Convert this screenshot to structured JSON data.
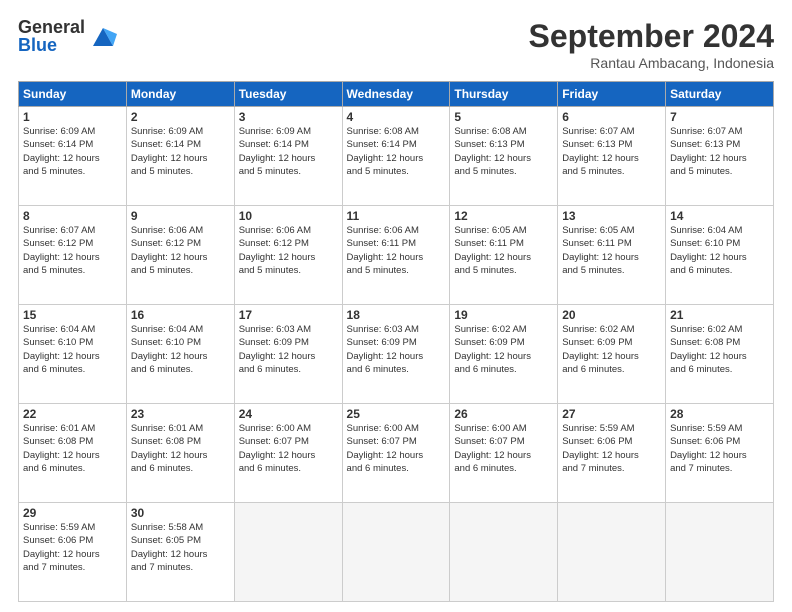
{
  "logo": {
    "general": "General",
    "blue": "Blue"
  },
  "header": {
    "month": "September 2024",
    "location": "Rantau Ambacang, Indonesia"
  },
  "weekdays": [
    "Sunday",
    "Monday",
    "Tuesday",
    "Wednesday",
    "Thursday",
    "Friday",
    "Saturday"
  ],
  "weeks": [
    [
      {
        "day": "1",
        "info": "Sunrise: 6:09 AM\nSunset: 6:14 PM\nDaylight: 12 hours\nand 5 minutes."
      },
      {
        "day": "2",
        "info": "Sunrise: 6:09 AM\nSunset: 6:14 PM\nDaylight: 12 hours\nand 5 minutes."
      },
      {
        "day": "3",
        "info": "Sunrise: 6:09 AM\nSunset: 6:14 PM\nDaylight: 12 hours\nand 5 minutes."
      },
      {
        "day": "4",
        "info": "Sunrise: 6:08 AM\nSunset: 6:14 PM\nDaylight: 12 hours\nand 5 minutes."
      },
      {
        "day": "5",
        "info": "Sunrise: 6:08 AM\nSunset: 6:13 PM\nDaylight: 12 hours\nand 5 minutes."
      },
      {
        "day": "6",
        "info": "Sunrise: 6:07 AM\nSunset: 6:13 PM\nDaylight: 12 hours\nand 5 minutes."
      },
      {
        "day": "7",
        "info": "Sunrise: 6:07 AM\nSunset: 6:13 PM\nDaylight: 12 hours\nand 5 minutes."
      }
    ],
    [
      {
        "day": "8",
        "info": "Sunrise: 6:07 AM\nSunset: 6:12 PM\nDaylight: 12 hours\nand 5 minutes."
      },
      {
        "day": "9",
        "info": "Sunrise: 6:06 AM\nSunset: 6:12 PM\nDaylight: 12 hours\nand 5 minutes."
      },
      {
        "day": "10",
        "info": "Sunrise: 6:06 AM\nSunset: 6:12 PM\nDaylight: 12 hours\nand 5 minutes."
      },
      {
        "day": "11",
        "info": "Sunrise: 6:06 AM\nSunset: 6:11 PM\nDaylight: 12 hours\nand 5 minutes."
      },
      {
        "day": "12",
        "info": "Sunrise: 6:05 AM\nSunset: 6:11 PM\nDaylight: 12 hours\nand 5 minutes."
      },
      {
        "day": "13",
        "info": "Sunrise: 6:05 AM\nSunset: 6:11 PM\nDaylight: 12 hours\nand 5 minutes."
      },
      {
        "day": "14",
        "info": "Sunrise: 6:04 AM\nSunset: 6:10 PM\nDaylight: 12 hours\nand 6 minutes."
      }
    ],
    [
      {
        "day": "15",
        "info": "Sunrise: 6:04 AM\nSunset: 6:10 PM\nDaylight: 12 hours\nand 6 minutes."
      },
      {
        "day": "16",
        "info": "Sunrise: 6:04 AM\nSunset: 6:10 PM\nDaylight: 12 hours\nand 6 minutes."
      },
      {
        "day": "17",
        "info": "Sunrise: 6:03 AM\nSunset: 6:09 PM\nDaylight: 12 hours\nand 6 minutes."
      },
      {
        "day": "18",
        "info": "Sunrise: 6:03 AM\nSunset: 6:09 PM\nDaylight: 12 hours\nand 6 minutes."
      },
      {
        "day": "19",
        "info": "Sunrise: 6:02 AM\nSunset: 6:09 PM\nDaylight: 12 hours\nand 6 minutes."
      },
      {
        "day": "20",
        "info": "Sunrise: 6:02 AM\nSunset: 6:09 PM\nDaylight: 12 hours\nand 6 minutes."
      },
      {
        "day": "21",
        "info": "Sunrise: 6:02 AM\nSunset: 6:08 PM\nDaylight: 12 hours\nand 6 minutes."
      }
    ],
    [
      {
        "day": "22",
        "info": "Sunrise: 6:01 AM\nSunset: 6:08 PM\nDaylight: 12 hours\nand 6 minutes."
      },
      {
        "day": "23",
        "info": "Sunrise: 6:01 AM\nSunset: 6:08 PM\nDaylight: 12 hours\nand 6 minutes."
      },
      {
        "day": "24",
        "info": "Sunrise: 6:00 AM\nSunset: 6:07 PM\nDaylight: 12 hours\nand 6 minutes."
      },
      {
        "day": "25",
        "info": "Sunrise: 6:00 AM\nSunset: 6:07 PM\nDaylight: 12 hours\nand 6 minutes."
      },
      {
        "day": "26",
        "info": "Sunrise: 6:00 AM\nSunset: 6:07 PM\nDaylight: 12 hours\nand 6 minutes."
      },
      {
        "day": "27",
        "info": "Sunrise: 5:59 AM\nSunset: 6:06 PM\nDaylight: 12 hours\nand 7 minutes."
      },
      {
        "day": "28",
        "info": "Sunrise: 5:59 AM\nSunset: 6:06 PM\nDaylight: 12 hours\nand 7 minutes."
      }
    ],
    [
      {
        "day": "29",
        "info": "Sunrise: 5:59 AM\nSunset: 6:06 PM\nDaylight: 12 hours\nand 7 minutes."
      },
      {
        "day": "30",
        "info": "Sunrise: 5:58 AM\nSunset: 6:05 PM\nDaylight: 12 hours\nand 7 minutes."
      },
      {
        "day": "",
        "info": ""
      },
      {
        "day": "",
        "info": ""
      },
      {
        "day": "",
        "info": ""
      },
      {
        "day": "",
        "info": ""
      },
      {
        "day": "",
        "info": ""
      }
    ]
  ]
}
